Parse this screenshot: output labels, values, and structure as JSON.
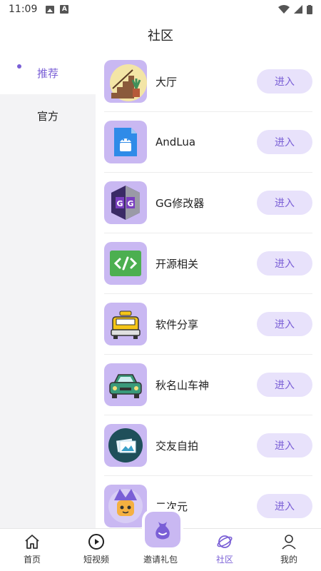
{
  "status_bar": {
    "time": "11:09"
  },
  "header": {
    "title": "社区"
  },
  "sidebar": {
    "items": [
      {
        "label": "推荐",
        "active": true
      },
      {
        "label": "官方",
        "active": false
      }
    ]
  },
  "list": {
    "enter_label": "进入",
    "items": [
      {
        "name": "大厅",
        "icon": "stairs-plant-icon"
      },
      {
        "name": "AndLua",
        "icon": "android-file-icon"
      },
      {
        "name": "GG修改器",
        "icon": "gg-shield-icon"
      },
      {
        "name": "开源相关",
        "icon": "code-icon"
      },
      {
        "name": "软件分享",
        "icon": "taxi-icon"
      },
      {
        "name": "秋名山车神",
        "icon": "car-icon"
      },
      {
        "name": "交友自拍",
        "icon": "photo-icon"
      },
      {
        "name": "二次元",
        "icon": "anime-character-icon"
      }
    ]
  },
  "bottom_nav": {
    "items": [
      {
        "label": "首页",
        "icon": "home-icon"
      },
      {
        "label": "短视频",
        "icon": "play-circle-icon"
      },
      {
        "label": "邀请礼包",
        "icon": "gift-bag-icon"
      },
      {
        "label": "社区",
        "icon": "planet-icon",
        "active": true
      },
      {
        "label": "我的",
        "icon": "user-icon"
      }
    ]
  },
  "colors": {
    "accent": "#7a5fd6",
    "accent_light": "#e8e2fb",
    "thumb_bg": "#c9b8f2"
  }
}
